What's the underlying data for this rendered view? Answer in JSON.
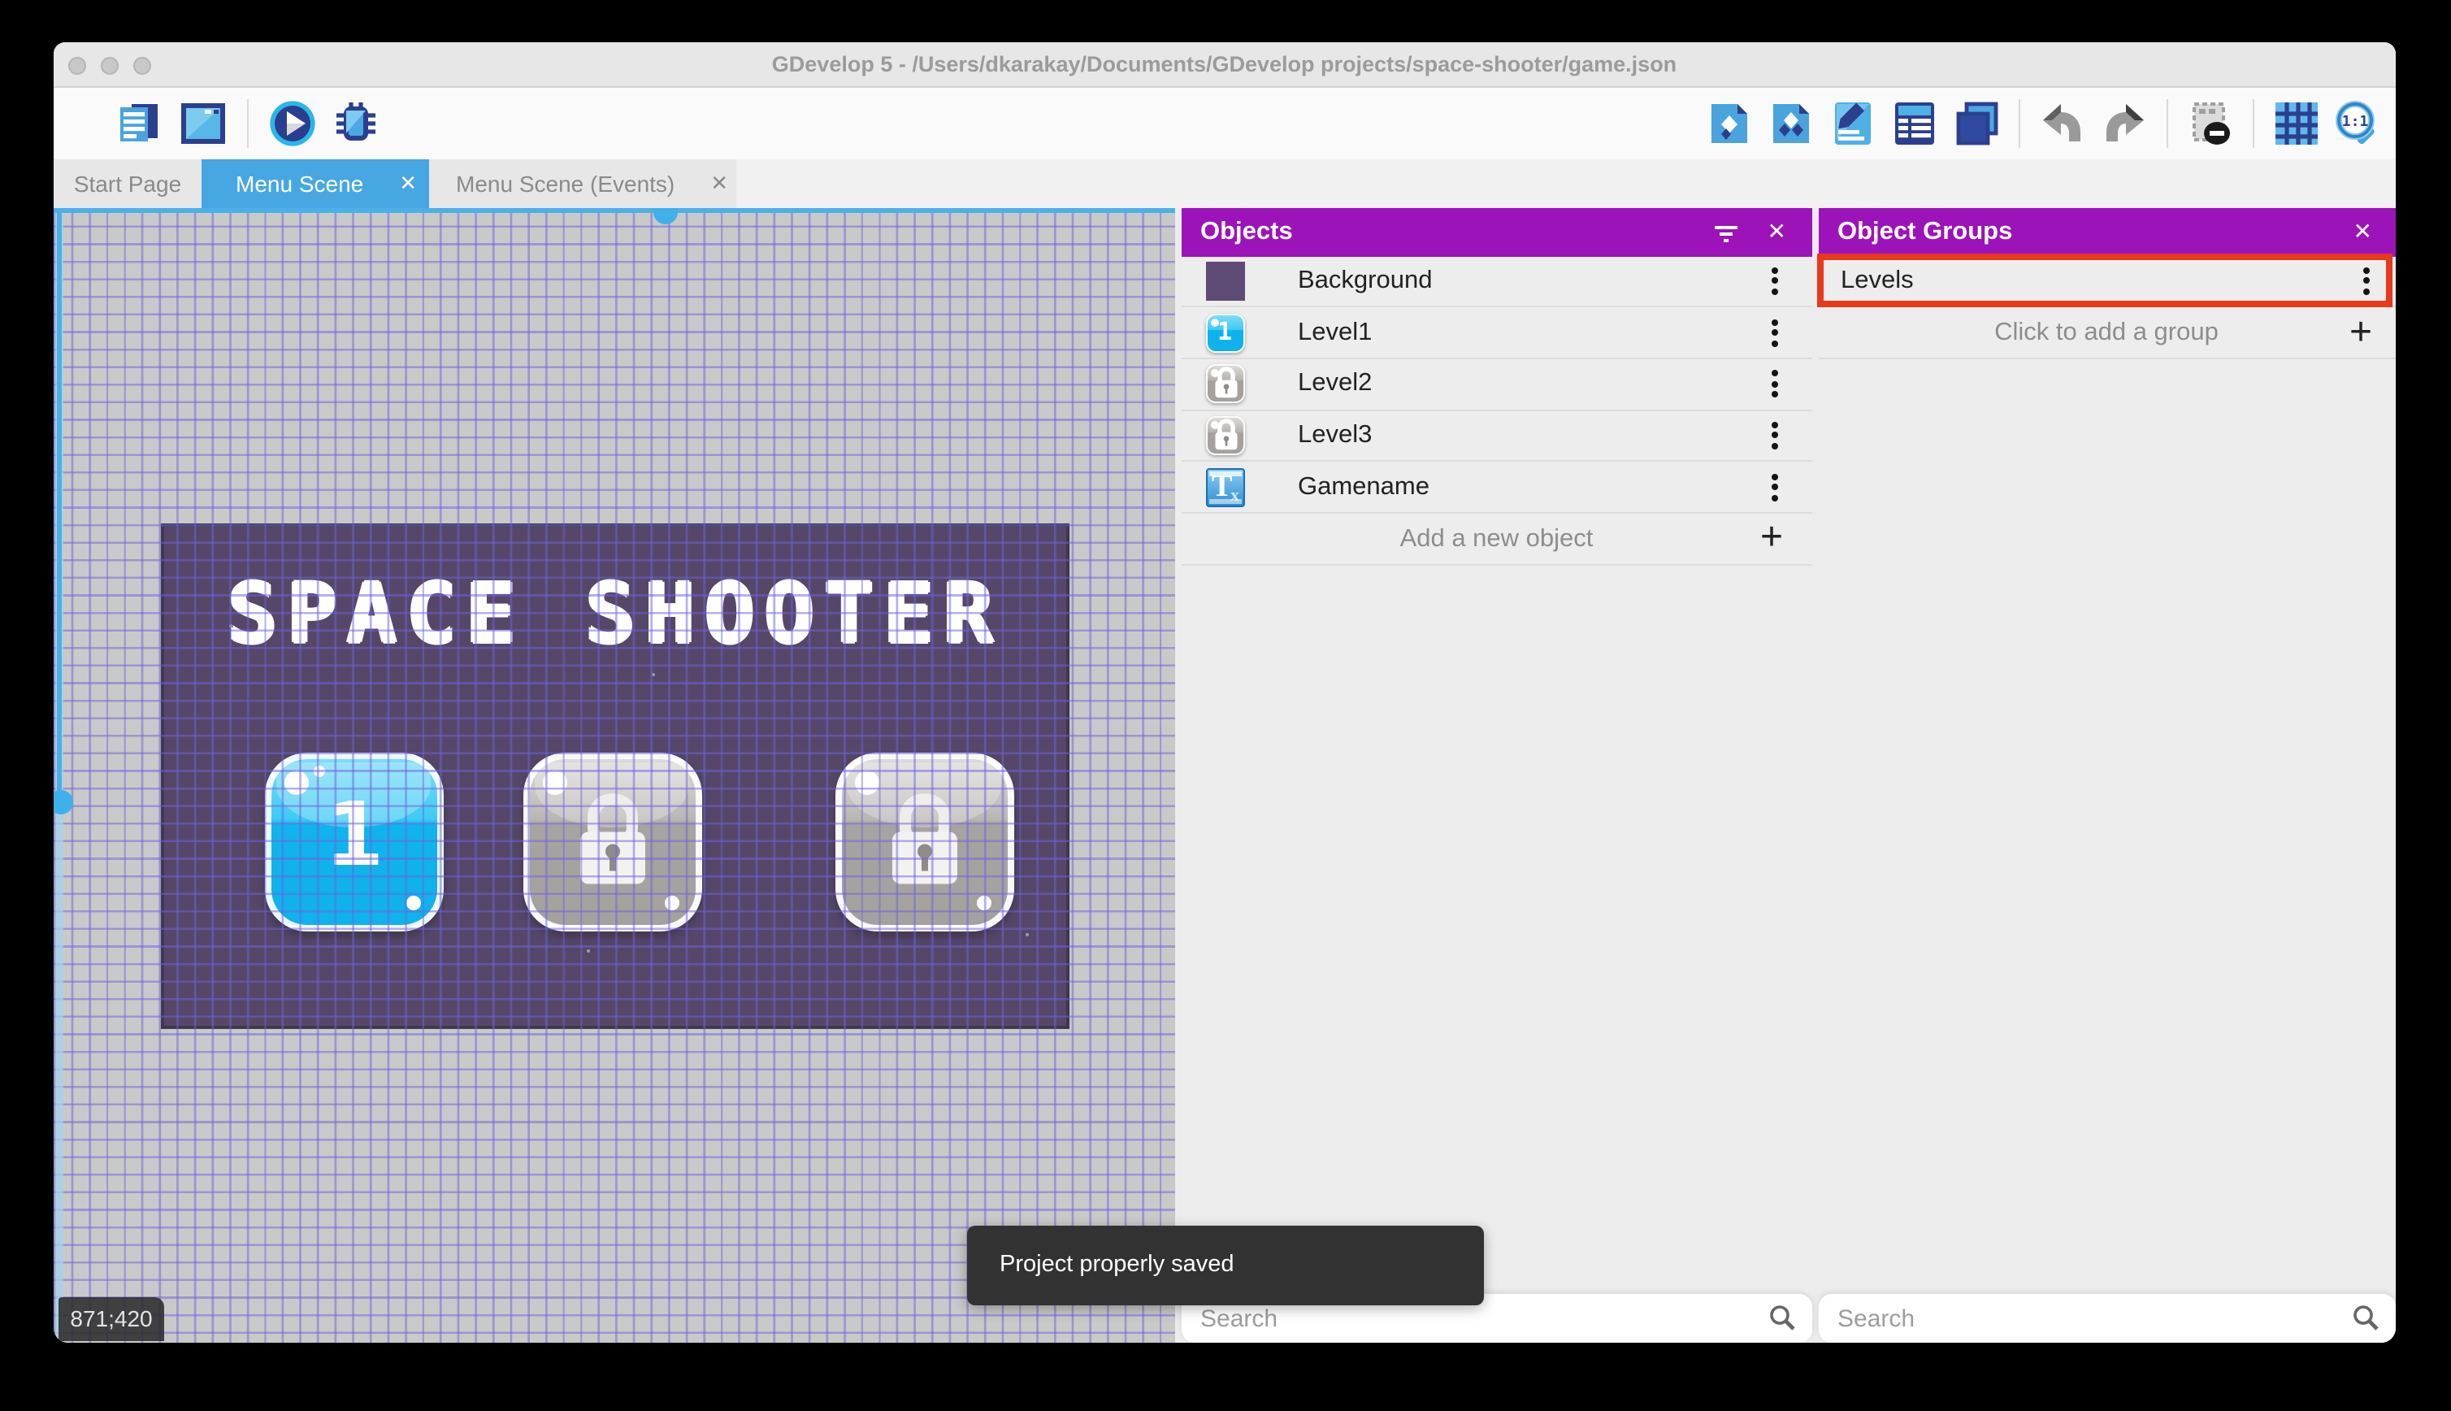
{
  "titlebar": {
    "title": "GDevelop 5 - /Users/dkarakay/Documents/GDevelop projects/space-shooter/game.json"
  },
  "tabs": {
    "items": [
      {
        "label": "Start Page"
      },
      {
        "label": "Menu Scene"
      },
      {
        "label": "Menu Scene (Events)"
      }
    ],
    "close_glyph": "✕"
  },
  "toolbar": {
    "left_icons": [
      "project-manager",
      "preview-window",
      "play",
      "debug"
    ],
    "right_icons": [
      "object-export",
      "object-groups",
      "edit-scene",
      "properties",
      "layers",
      "undo",
      "redo",
      "mask",
      "grid",
      "zoom-1-1"
    ]
  },
  "canvas": {
    "coordinate_readout": "871;420"
  },
  "scene": {
    "title": "SPACE SHOOTER",
    "level1_label": "1"
  },
  "objects_panel": {
    "title": "Objects",
    "items": [
      {
        "label": "Background"
      },
      {
        "label": "Level1"
      },
      {
        "label": "Level2"
      },
      {
        "label": "Level3"
      },
      {
        "label": "Gamename"
      }
    ],
    "add_label": "Add a new object",
    "add_glyph": "+",
    "search_placeholder": "Search"
  },
  "groups_panel": {
    "title": "Object Groups",
    "items": [
      {
        "label": "Levels"
      }
    ],
    "add_label": "Click to add a group",
    "add_glyph": "+",
    "search_placeholder": "Search"
  },
  "toast": {
    "message": "Project properly saved"
  },
  "colors": {
    "accent_purple": "#9c13b9",
    "tab_active": "#47a7e3",
    "selection_blue": "#4ab1e8",
    "annotation_red": "#e8391d"
  }
}
